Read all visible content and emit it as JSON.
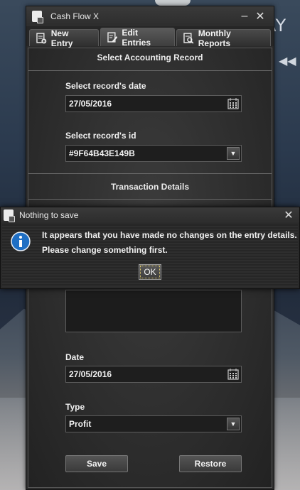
{
  "background": {
    "corner_text": "AY"
  },
  "window": {
    "title": "Cash Flow X",
    "minimize_label": "–",
    "close_label": "✕"
  },
  "tabs": [
    {
      "label": "New Entry",
      "icon": "new-entry-icon"
    },
    {
      "label": "Edit Entries",
      "icon": "edit-entries-icon",
      "active": true
    },
    {
      "label": "Monthly Reports",
      "icon": "reports-icon"
    }
  ],
  "select_section": {
    "title": "Select Accounting Record",
    "date_label": "Select record's date",
    "date_value": "27/05/2016",
    "id_label": "Select record's id",
    "id_value": "#9F64B43E149B"
  },
  "details_section": {
    "title": "Transaction Details",
    "date_label": "Date",
    "date_value": "27/05/2016",
    "type_label": "Type",
    "type_value": "Profit"
  },
  "actions": {
    "save_label": "Save",
    "restore_label": "Restore"
  },
  "dialog": {
    "title": "Nothing to save",
    "close_label": "✕",
    "message_line1": "It appears that you have made no changes on the entry details.",
    "message_line2": "Please change something first.",
    "ok_label": "OK"
  },
  "colors": {
    "window_bg": "#2b2b2b",
    "info_blue": "#1f6fc4"
  }
}
